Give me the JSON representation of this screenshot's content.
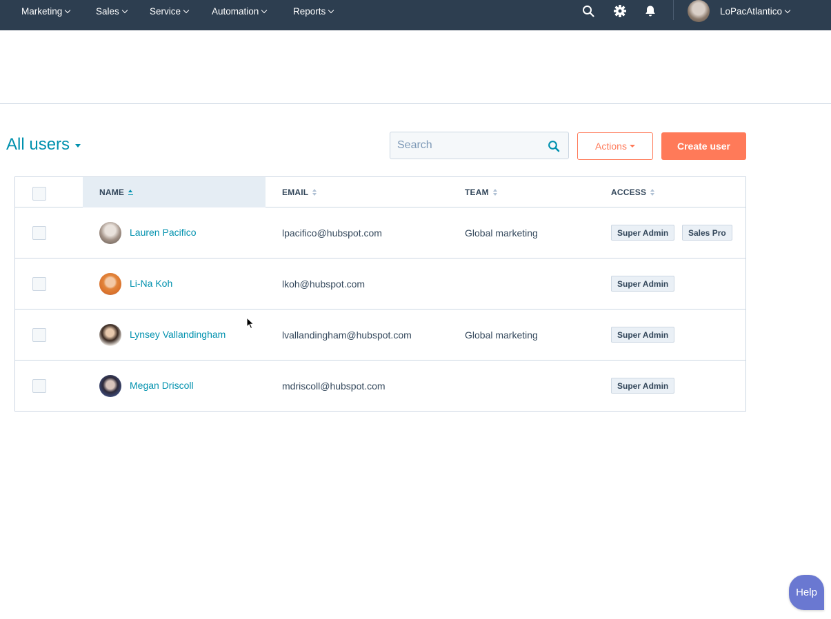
{
  "topnav": {
    "items": [
      {
        "label": "Marketing"
      },
      {
        "label": "Sales"
      },
      {
        "label": "Service"
      },
      {
        "label": "Automation"
      },
      {
        "label": "Reports"
      }
    ],
    "icons": [
      "search-icon",
      "gear-icon",
      "bell-icon"
    ],
    "account_name": "LoPacAtlantico"
  },
  "page": {
    "title": "All users"
  },
  "search": {
    "placeholder": "Search",
    "value": ""
  },
  "toolbar": {
    "actions_label": "Actions",
    "create_label": "Create user"
  },
  "table": {
    "columns": [
      {
        "label": "NAME",
        "sorted": "ascending"
      },
      {
        "label": "EMAIL"
      },
      {
        "label": "TEAM"
      },
      {
        "label": "ACCESS"
      }
    ],
    "rows": [
      {
        "name": "Lauren Pacifico",
        "email": "lpacifico@hubspot.com",
        "team": "Global marketing",
        "access": [
          "Super Admin",
          "Sales Pro"
        ]
      },
      {
        "name": "Li-Na Koh",
        "email": "lkoh@hubspot.com",
        "team": "",
        "access": [
          "Super Admin"
        ]
      },
      {
        "name": "Lynsey Vallandingham",
        "email": "lvallandingham@hubspot.com",
        "team": "Global marketing",
        "access": [
          "Super Admin"
        ]
      },
      {
        "name": "Megan Driscoll",
        "email": "mdriscoll@hubspot.com",
        "team": "",
        "access": [
          "Super Admin"
        ]
      }
    ]
  },
  "help": {
    "label": "Help"
  },
  "colors": {
    "nav_bg": "#2d3e50",
    "link": "#0091ae",
    "accent": "#ff7a59",
    "help": "#6a78d1"
  }
}
